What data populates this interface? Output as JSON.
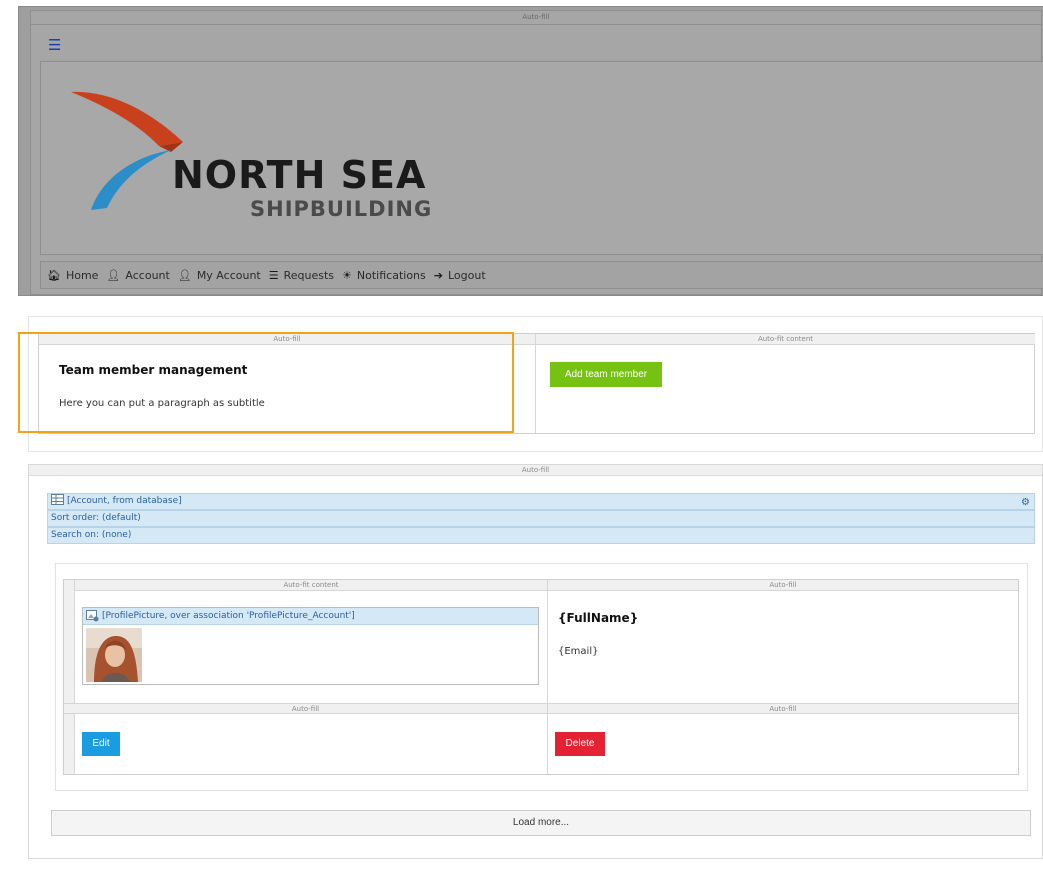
{
  "header": {
    "autofill_label": "Auto-fill",
    "menu_icon": "☰",
    "logo": {
      "line1": "NORTH SEA",
      "line2": "SHIPBUILDING",
      "colors": {
        "sail": "#c8401c",
        "wave": "#2b8ec8"
      }
    },
    "nav": [
      {
        "icon": "home-icon",
        "glyph": "🏠︎",
        "label": "Home"
      },
      {
        "icon": "user-icon",
        "glyph": "👤︎",
        "label": "Account"
      },
      {
        "icon": "user-icon",
        "glyph": "👤︎",
        "label": "My Account"
      },
      {
        "icon": "list-icon",
        "glyph": "☰",
        "label": "Requests"
      },
      {
        "icon": "notification-icon",
        "glyph": "☀",
        "label": "Notifications"
      },
      {
        "icon": "logout-icon",
        "glyph": "➔",
        "label": "Logout"
      }
    ]
  },
  "section1": {
    "col_left_label": "Auto-fill",
    "col_right_label": "Auto-fit content",
    "title": "Team member management",
    "subtitle": "Here you can put a paragraph as subtitle",
    "add_button": "Add team member",
    "colors": {
      "highlight": "#f4a21a",
      "add_button": "#76c212"
    }
  },
  "section2": {
    "autofill_label": "Auto-fill",
    "datasource": "[Account, from database]",
    "sort_order": "Sort order: (default)",
    "search_on": "Search on: (none)",
    "grid": {
      "top_left_label": "Auto-fit content",
      "top_right_label": "Auto-fill",
      "bottom_left_label": "Auto-fill",
      "bottom_right_label": "Auto-fill"
    },
    "image_source": "[ProfilePicture, over association 'ProfilePicture_Account']",
    "fullname": "{FullName}",
    "email": "{Email}",
    "edit_button": "Edit",
    "delete_button": "Delete",
    "load_more": "Load more...",
    "colors": {
      "edit_button": "#1b9be0",
      "delete_button": "#e32233",
      "datasource_bar": "#d5e8f6"
    }
  }
}
